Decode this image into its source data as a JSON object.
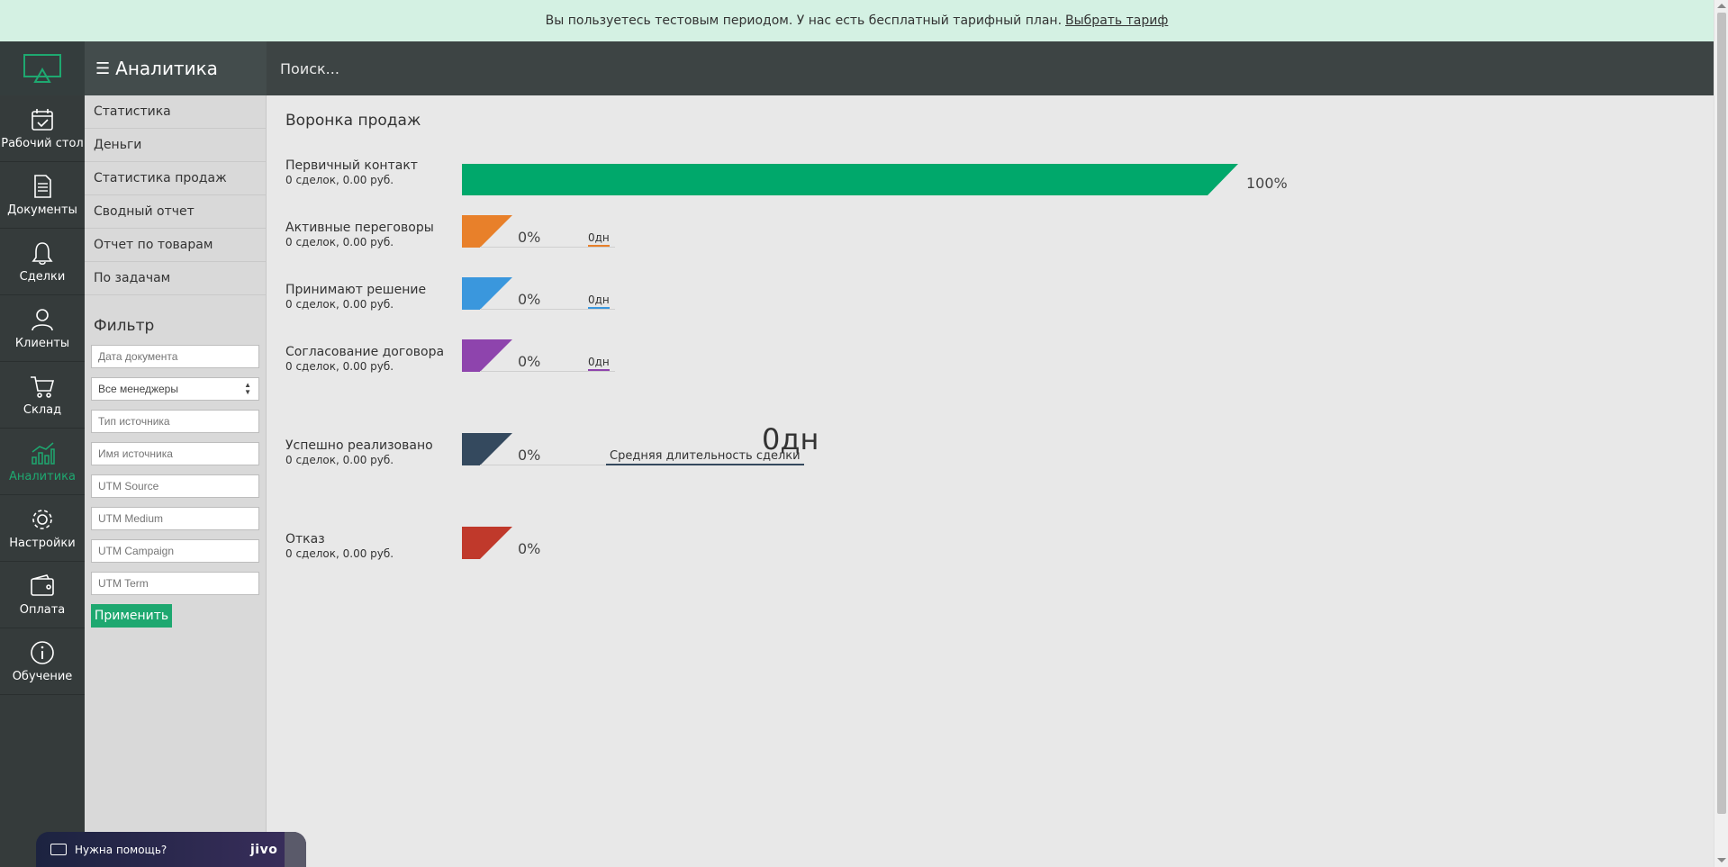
{
  "banner": {
    "text": "Вы пользуетесь тестовым периодом. У нас есть бесплатный тарифный план.",
    "link": "Выбрать тариф"
  },
  "header": {
    "section_title": "Аналитика",
    "search_placeholder": "Поиск..."
  },
  "nav": [
    {
      "label": "Рабочий стол",
      "icon": "calendar-icon"
    },
    {
      "label": "Документы",
      "icon": "document-icon"
    },
    {
      "label": "Сделки",
      "icon": "bell-icon"
    },
    {
      "label": "Клиенты",
      "icon": "users-icon"
    },
    {
      "label": "Склад",
      "icon": "cart-icon"
    },
    {
      "label": "Аналитика",
      "icon": "chart-icon",
      "active": true
    },
    {
      "label": "Настройки",
      "icon": "gear-icon"
    },
    {
      "label": "Оплата",
      "icon": "wallet-icon"
    },
    {
      "label": "Обучение",
      "icon": "info-icon"
    }
  ],
  "submenu": [
    "Статистика",
    "Деньги",
    "Статистика продаж",
    "Сводный отчет",
    "Отчет по товарам",
    "По задачам"
  ],
  "filter": {
    "title": "Фильтр",
    "date_placeholder": "Дата документа",
    "manager_selected": "Все менеджеры",
    "source_type_placeholder": "Тип источника",
    "source_name_placeholder": "Имя источника",
    "utm_source_placeholder": "UTM Source",
    "utm_medium_placeholder": "UTM Medium",
    "utm_campaign_placeholder": "UTM Campaign",
    "utm_term_placeholder": "UTM Term",
    "apply_label": "Применить"
  },
  "funnel": {
    "title": "Воронка продаж",
    "stages": [
      {
        "name": "Первичный контакт",
        "summary": "0 сделок, 0.00 руб.",
        "percent": "100%",
        "share": 1.0,
        "color": "#00a86b",
        "duration": ""
      },
      {
        "name": "Активные переговоры",
        "summary": "0 сделок, 0.00 руб.",
        "percent": "0%",
        "share": 0.0,
        "color": "#e8802a",
        "duration": "0дн"
      },
      {
        "name": "Принимают решение",
        "summary": "0 сделок, 0.00 руб.",
        "percent": "0%",
        "share": 0.0,
        "color": "#3a97dd",
        "duration": "0дн"
      },
      {
        "name": "Согласование договора",
        "summary": "0 сделок, 0.00 руб.",
        "percent": "0%",
        "share": 0.0,
        "color": "#8e44ad",
        "duration": "0дн"
      },
      {
        "name": "Успешно реализовано",
        "summary": "0 сделок, 0.00 руб.",
        "percent": "0%",
        "share": 0.0,
        "color": "#34495e",
        "duration": ""
      },
      {
        "name": "Отказ",
        "summary": "0 сделок, 0.00 руб.",
        "percent": "0%",
        "share": 0.0,
        "color": "#c0392b",
        "duration": ""
      }
    ],
    "avg_duration_value": "0дн",
    "avg_duration_label": "Средняя длительность сделки"
  },
  "jivo": {
    "help_text": "Нужна помощь?",
    "brand": "jivo"
  }
}
